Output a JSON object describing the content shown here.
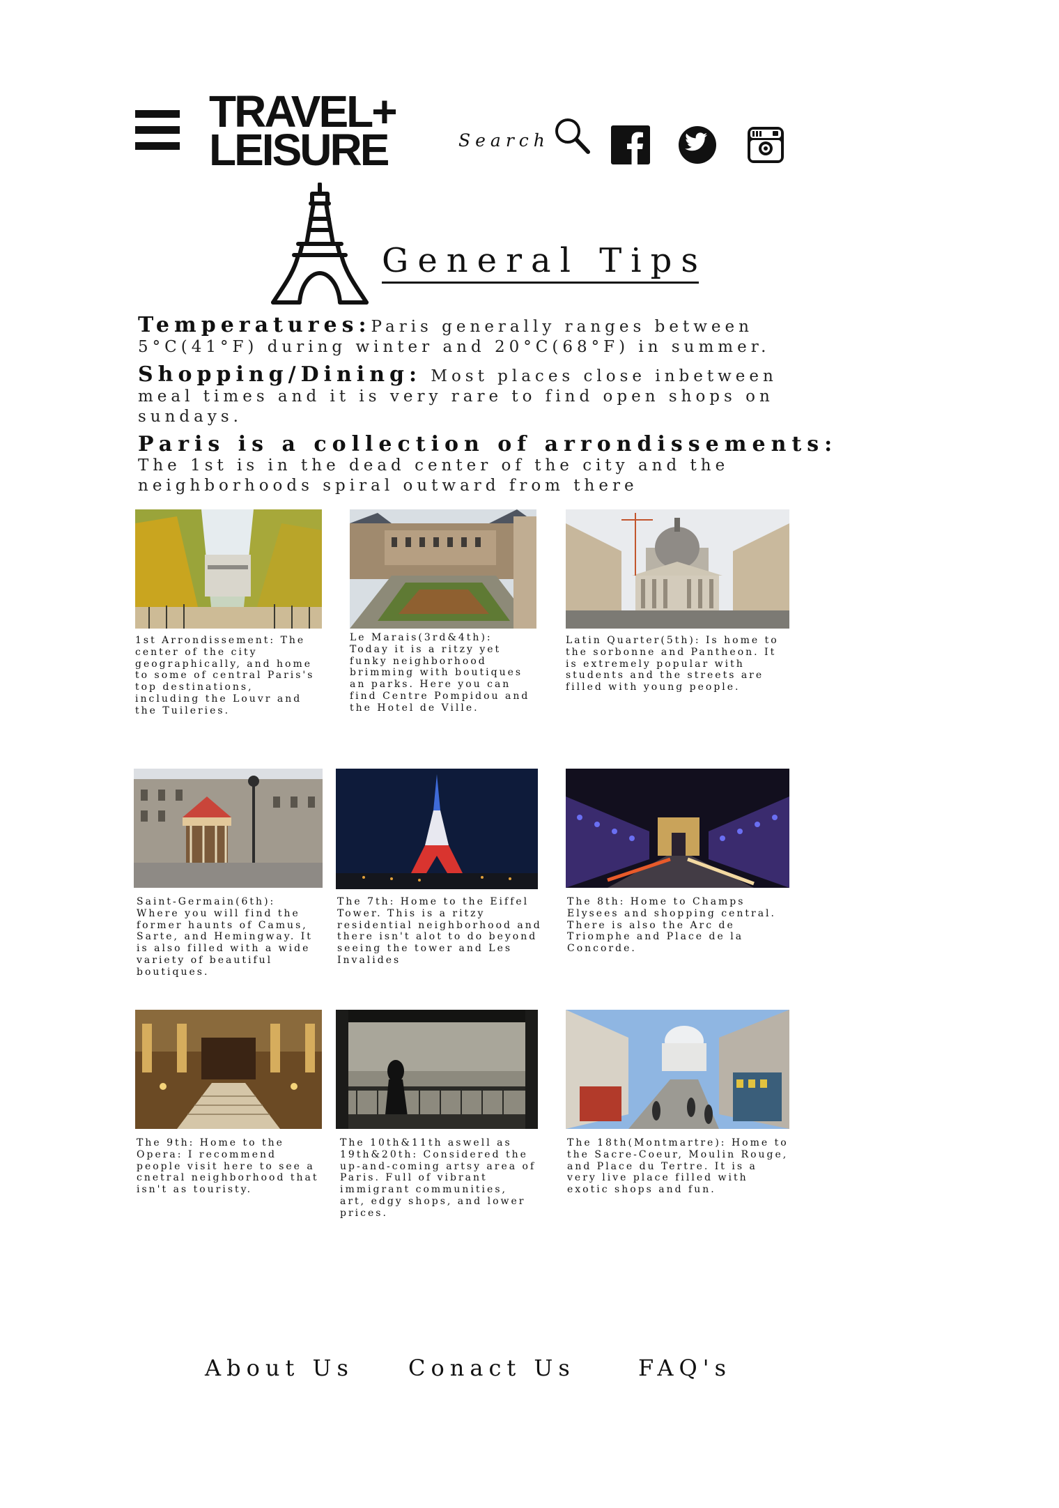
{
  "header": {
    "logo_line1": "TRAVEL+",
    "logo_line2": "LEISURE",
    "search_label": "Search",
    "icons": [
      "menu-icon",
      "search-icon",
      "facebook-icon",
      "twitter-icon",
      "instagram-icon"
    ]
  },
  "title": "General Tips",
  "tips": {
    "temperatures_label": "Temperatures:",
    "temperatures_text": "Paris generally ranges between 5°C(41°F) during winter and 20°C(68°F) in summer.",
    "shopping_label": "Shopping/Dining:",
    "shopping_text": " Most places close inbetween meal times and it is very rare to find open shops on sundays.",
    "arrondissements_heading": "Paris is a collection of arrondissements:",
    "arrondissements_text": "The 1st is in the dead center of the city and the neighborhoods spiral outward from there"
  },
  "gallery": [
    {
      "caption": "1st Arrondissement: The center of the city geographically, and home to some of central Paris's top destinations, including the Louvr and the Tuileries."
    },
    {
      "caption": "Le Marais(3rd&4th): Today it is a ritzy yet funky neighborhood brimming with boutiques an parks. Here you can find Centre Pompidou and the Hotel de Ville."
    },
    {
      "caption": "Latin Quarter(5th): Is home to the sorbonne and Pantheon. It is extremely popular with students and the streets are filled with young people."
    },
    {
      "caption": "Saint-Germain(6th): Where you will find the former haunts of Camus, Sarte, and Hemingway. It is also filled with a wide variety of beautiful boutiques."
    },
    {
      "caption": "The 7th: Home to the Eiffel Tower. This is a ritzy residential neighborhood and there isn't alot to do beyond seeing the tower and Les Invalides"
    },
    {
      "caption": "The 8th: Home to Champs Elysees and shopping central. There is also the Arc de Triomphe and Place de la Concorde."
    },
    {
      "caption": "The 9th: Home to the Opera: I recommend people visit here to see a cnetral neighborhood that isn't as touristy."
    },
    {
      "caption": "The 10th&11th aswell as 19th&20th: Considered the up-and-coming artsy area of Paris. Full of vibrant immigrant communities, art, edgy shops, and lower prices."
    },
    {
      "caption": "The 18th(Montmartre): Home to the Sacre-Coeur, Moulin Rouge, and Place du Tertre. It is a very live place filled with exotic shops and fun."
    }
  ],
  "footer": {
    "about": "About Us",
    "contact": "Conact Us",
    "faq": "FAQ's"
  }
}
